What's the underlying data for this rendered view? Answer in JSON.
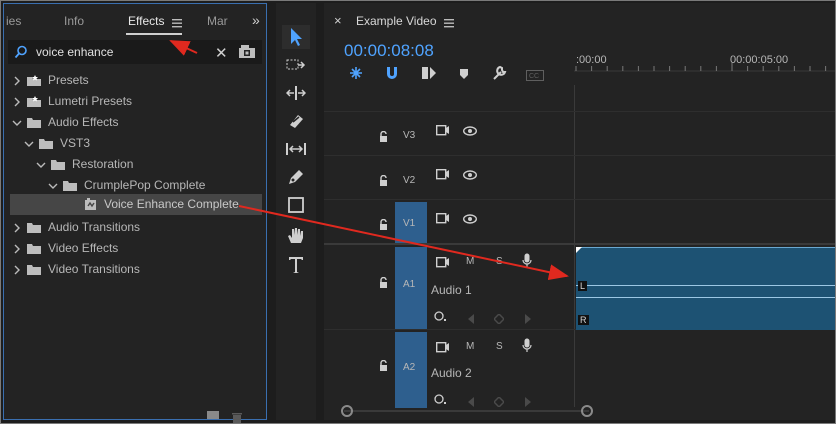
{
  "effects_panel": {
    "tabs": [
      "ies",
      "Info",
      "Effects",
      "Mar"
    ],
    "overflow_glyph": "»",
    "search": {
      "value": "voice enhance",
      "placeholder": ""
    },
    "tree": [
      {
        "label": "Presets",
        "icon": "preset-folder-icon",
        "expanded": false
      },
      {
        "label": "Lumetri Presets",
        "icon": "preset-folder-icon",
        "expanded": false
      },
      {
        "label": "Audio Effects",
        "icon": "folder-icon",
        "expanded": true
      },
      {
        "label": "VST3",
        "icon": "folder-icon",
        "expanded": true
      },
      {
        "label": "Restoration",
        "icon": "folder-icon",
        "expanded": true
      },
      {
        "label": "CrumplePop Complete",
        "icon": "folder-icon",
        "expanded": true
      },
      {
        "label": "Voice Enhance Complete",
        "icon": "effect-icon",
        "selected": true
      },
      {
        "label": "Audio Transitions",
        "icon": "folder-icon",
        "expanded": false
      },
      {
        "label": "Video Effects",
        "icon": "folder-icon",
        "expanded": false
      },
      {
        "label": "Video Transitions",
        "icon": "folder-icon",
        "expanded": false
      }
    ]
  },
  "tools": [
    "selection-tool-icon",
    "track-select-icon",
    "ripple-edit-icon",
    "razor-icon",
    "slip-icon",
    "pen-icon",
    "rectangle-icon",
    "hand-icon",
    "type-icon"
  ],
  "timeline": {
    "sequence_name": "Example Video",
    "close_glyph": "×",
    "timecode": "00:00:08:08",
    "ruler_labels": [
      ":00:00",
      "00:00:05:00"
    ],
    "tracks": {
      "video": [
        "V3",
        "V2",
        "V1"
      ],
      "audio": [
        {
          "name": "A1",
          "label": "Audio 1",
          "m": "M",
          "s": "S"
        },
        {
          "name": "A2",
          "label": "Audio 2",
          "m": "M",
          "s": "S"
        }
      ]
    },
    "clip": {
      "left_channel": "L",
      "right_channel": "R"
    }
  },
  "colors": {
    "accent": "#4fa3ff",
    "clip": "#1d5273",
    "arrow": "#e0291f"
  }
}
